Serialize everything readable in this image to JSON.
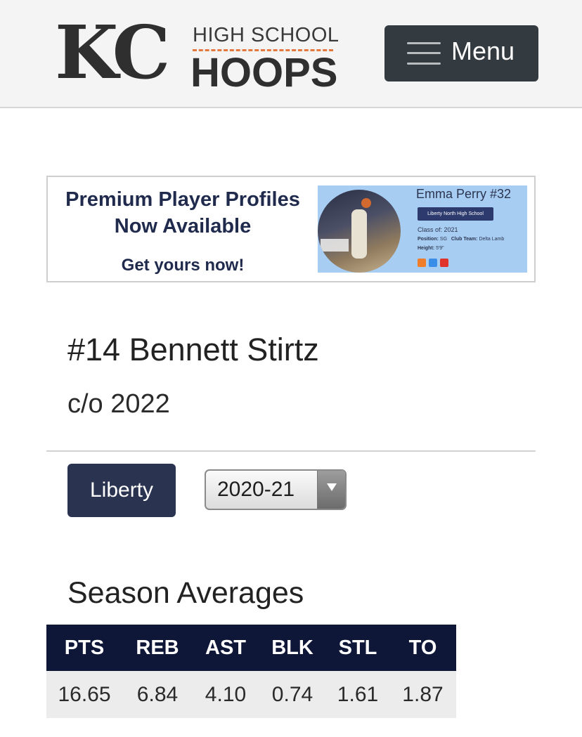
{
  "header": {
    "logo": {
      "kc": "KC",
      "line1": "HIGH SCHOOL",
      "line2": "HOOPS"
    },
    "menu_label": "Menu"
  },
  "banner": {
    "headline_line1": "Premium Player Profiles",
    "headline_line2": "Now Available",
    "cta": "Get yours now!",
    "sample_profile": {
      "name": "Emma Perry #32",
      "school": "Liberty North High School",
      "class": "Class of: 2021",
      "position_label": "Position:",
      "position": "SG",
      "club_label": "Club Team:",
      "club": "Delta Lamb",
      "height_label": "Height:",
      "height": "5'9\"",
      "social_icons": [
        "hudl-icon",
        "twitter-icon",
        "youtube-icon"
      ],
      "icon_colors": [
        "#f07d2a",
        "#3b8ee8",
        "#e0332c"
      ]
    }
  },
  "player": {
    "name": "#14 Bennett Stirtz",
    "class": "c/o 2022",
    "team_button": "Liberty",
    "season_selected": "2020-21"
  },
  "season_averages": {
    "title": "Season Averages",
    "headers": [
      "PTS",
      "REB",
      "AST",
      "BLK",
      "STL",
      "TO"
    ],
    "values": [
      "16.65",
      "6.84",
      "4.10",
      "0.74",
      "1.61",
      "1.87"
    ]
  },
  "colors": {
    "header_bg": "#f4f4f4",
    "menu_bg": "#333a40",
    "team_button_bg": "#2a3450",
    "table_header_bg": "#0f1738",
    "table_row_bg": "#ececec",
    "banner_panel_bg": "#a8cdf2",
    "logo_accent": "#e3793f"
  }
}
